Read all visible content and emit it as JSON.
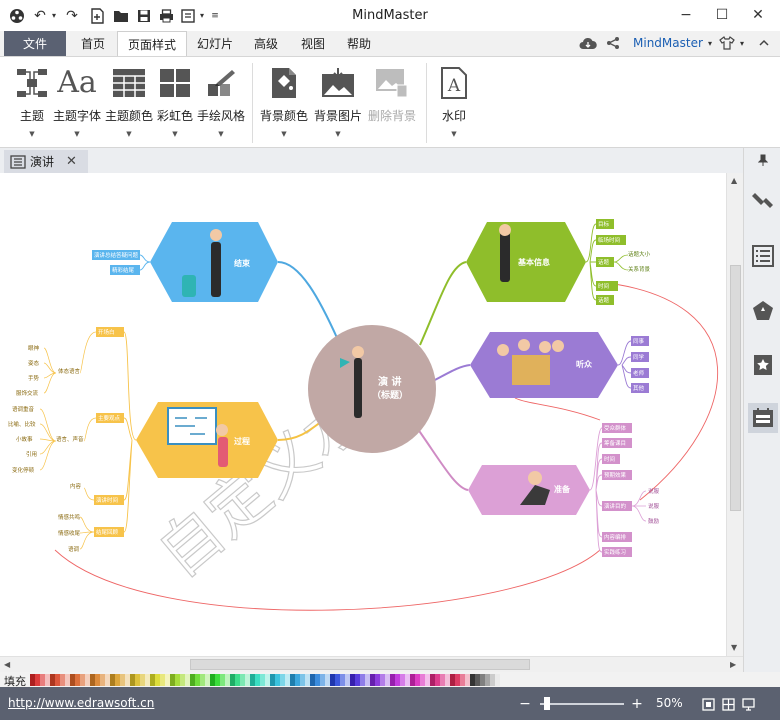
{
  "window": {
    "title": "MindMaster",
    "minimize": "−",
    "maximize": "☐",
    "close": "✕"
  },
  "menu": {
    "file": "文件",
    "tabs": [
      "首页",
      "页面样式",
      "幻灯片",
      "高级",
      "视图",
      "帮助"
    ],
    "active_tab": "页面样式",
    "brand": "MindMaster"
  },
  "ribbon": {
    "theme": "主题",
    "theme_font": "主题字体",
    "theme_color": "主题颜色",
    "rainbow": "彩虹色",
    "hand_drawn": "手绘风格",
    "bg_color": "背景颜色",
    "bg_image": "背景图片",
    "remove_bg": "删除背景",
    "watermark": "水印"
  },
  "document": {
    "tab_label": "演讲"
  },
  "mindmap": {
    "center": {
      "title": "演  讲",
      "subtitle": "（标题）"
    },
    "watermark_text": "自定义水印",
    "topics": [
      {
        "label": "基本信息",
        "items": [
          "目标",
          "临场时间",
          "话题",
          "时间",
          "话题"
        ],
        "subitems": [
          "话题大小",
          "关系背景"
        ]
      },
      {
        "label": "听众",
        "items": [
          "同事",
          "同学",
          "老师",
          "其他"
        ]
      },
      {
        "label": "准备",
        "items": [
          "受众群体",
          "筹备课目",
          "时间",
          "预期效果",
          "演讲目的",
          "内容编排",
          "实践练习"
        ],
        "subitems": [
          "说服",
          "说服",
          "鼓励"
        ]
      },
      {
        "label": "结束",
        "items": [
          "演讲总结答疑问题",
          "精彩结尾"
        ]
      },
      {
        "label": "过程",
        "items": [
          "开场白",
          "主要观点",
          "体态语言",
          "语言、声音",
          "内容",
          "演讲时间",
          "结尾回顾"
        ],
        "subitems": [
          "眼神",
          "姿态",
          "手势",
          "服饰交流",
          "语调重音",
          "比喻、比较",
          "小故事",
          "引用",
          "变化停顿",
          "情感共鸣",
          "情感收尾",
          "语调"
        ]
      }
    ]
  },
  "palette": {
    "label": "填充"
  },
  "status": {
    "url": "http://www.edrawsoft.cn",
    "zoom": "50%"
  },
  "colors": {
    "accent": "#1b5fb3",
    "status_bg": "#5b6170",
    "file_tab": "#5a6172"
  }
}
